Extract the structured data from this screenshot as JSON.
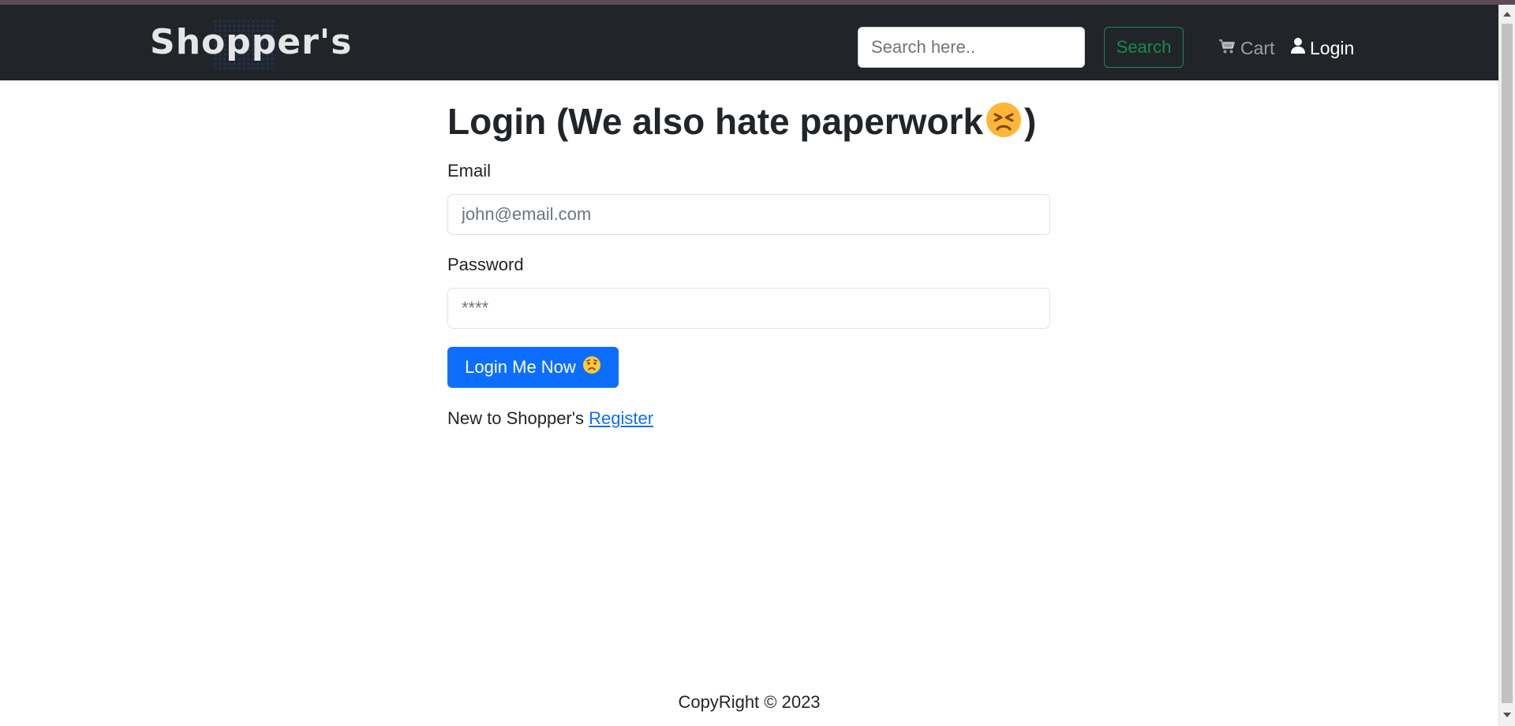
{
  "navbar": {
    "brand": "Shopper's",
    "search": {
      "placeholder": "Search here..",
      "value": ""
    },
    "search_button": "Search",
    "links": [
      {
        "label": "Cart",
        "icon": "cart-icon"
      },
      {
        "label": "Login",
        "icon": "user-icon"
      }
    ]
  },
  "main": {
    "title_before": "Login (We also hate paperwork",
    "title_after": ")",
    "title_emoji": "persevering-face-emoji",
    "email_label": "Email",
    "email_placeholder": "john@email.com",
    "password_label": "Password",
    "password_placeholder": "****",
    "login_button": "Login Me Now",
    "login_button_emoji": "worried-face-emoji",
    "register_prompt": "New to Shopper's",
    "register_link": "Register"
  },
  "footer": {
    "copyright": "CopyRight © 2023"
  },
  "colors": {
    "navbar_bg": "#212529",
    "primary": "#0d6efd",
    "success": "#198754",
    "text": "#212529"
  }
}
